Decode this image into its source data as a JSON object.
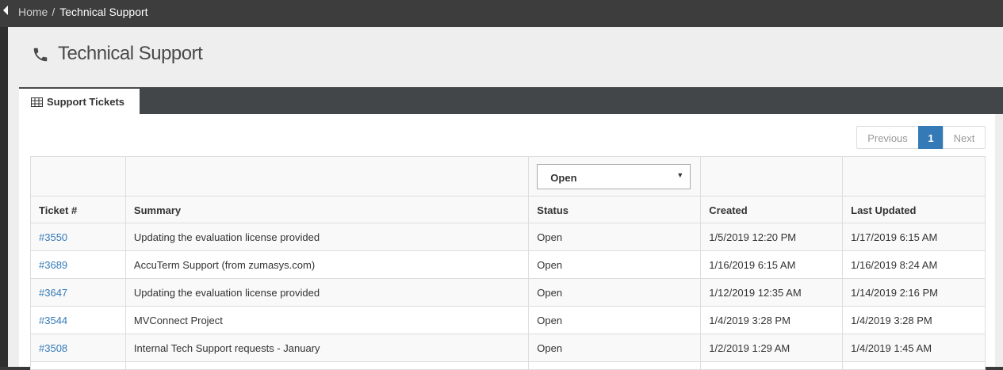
{
  "breadcrumb": {
    "home": "Home",
    "separator": "/",
    "current": "Technical Support"
  },
  "page": {
    "title": "Technical Support",
    "icon": "phone-icon"
  },
  "tab": {
    "label": "Support Tickets",
    "icon": "table-grid-icon"
  },
  "pagination": {
    "previous": "Previous",
    "current_page": "1",
    "next": "Next"
  },
  "filters": {
    "status_selected": "Open"
  },
  "table": {
    "headers": [
      "Ticket #",
      "Summary",
      "Status",
      "Created",
      "Last Updated"
    ],
    "rows": [
      {
        "ticket": "#3550",
        "summary": "Updating the evaluation license provided",
        "status": "Open",
        "created": "1/5/2019 12:20 PM",
        "updated": "1/17/2019 6:15 AM"
      },
      {
        "ticket": "#3689",
        "summary": "AccuTerm Support (from zumasys.com)",
        "status": "Open",
        "created": "1/16/2019 6:15 AM",
        "updated": "1/16/2019 8:24 AM"
      },
      {
        "ticket": "#3647",
        "summary": "Updating the evaluation license provided",
        "status": "Open",
        "created": "1/12/2019 12:35 AM",
        "updated": "1/14/2019 2:16 PM"
      },
      {
        "ticket": "#3544",
        "summary": "MVConnect Project",
        "status": "Open",
        "created": "1/4/2019 3:28 PM",
        "updated": "1/4/2019 3:28 PM"
      },
      {
        "ticket": "#3508",
        "summary": "Internal Tech Support requests - January",
        "status": "Open",
        "created": "1/2/2019 1:29 AM",
        "updated": "1/4/2019 1:45 AM"
      }
    ]
  },
  "colors": {
    "topbar": "#3d3d3d",
    "panel_bar": "#434649",
    "link": "#337ab7",
    "page_active": "#337ab7"
  }
}
